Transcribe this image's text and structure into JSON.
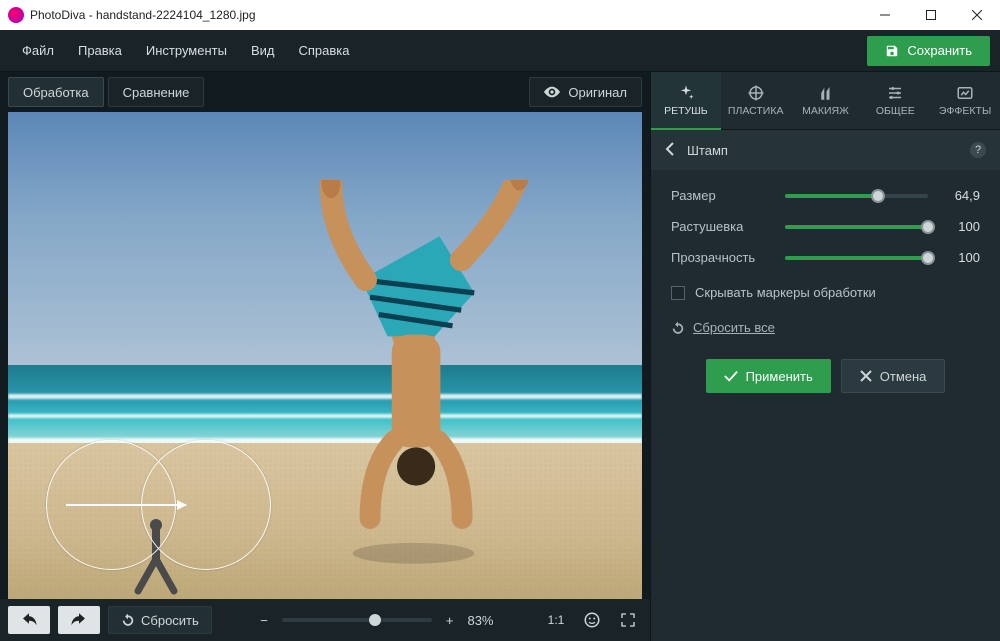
{
  "window": {
    "title": "PhotoDiva - handstand-2224104_1280.jpg"
  },
  "menu": {
    "file": "Файл",
    "edit": "Правка",
    "tools": "Инструменты",
    "view": "Вид",
    "help": "Справка",
    "save": "Сохранить"
  },
  "canvas": {
    "tab_process": "Обработка",
    "tab_compare": "Сравнение",
    "original_btn": "Оригинал",
    "reset_btn": "Сбросить",
    "zoom_pct": "83%",
    "one_to_one": "1:1"
  },
  "tooltabs": {
    "retouch": "РЕТУШЬ",
    "liquify": "ПЛАСТИКА",
    "makeup": "МАКИЯЖ",
    "general": "ОБЩЕЕ",
    "effects": "ЭФФЕКТЫ"
  },
  "panel": {
    "title": "Штамп",
    "size_label": "Размер",
    "size_value": "64,9",
    "size_pct": 65,
    "feather_label": "Растушевка",
    "feather_value": "100",
    "feather_pct": 100,
    "opacity_label": "Прозрачность",
    "opacity_value": "100",
    "opacity_pct": 100,
    "hide_markers": "Скрывать маркеры обработки",
    "reset_all": "Сбросить все",
    "apply": "Применить",
    "cancel": "Отмена"
  }
}
